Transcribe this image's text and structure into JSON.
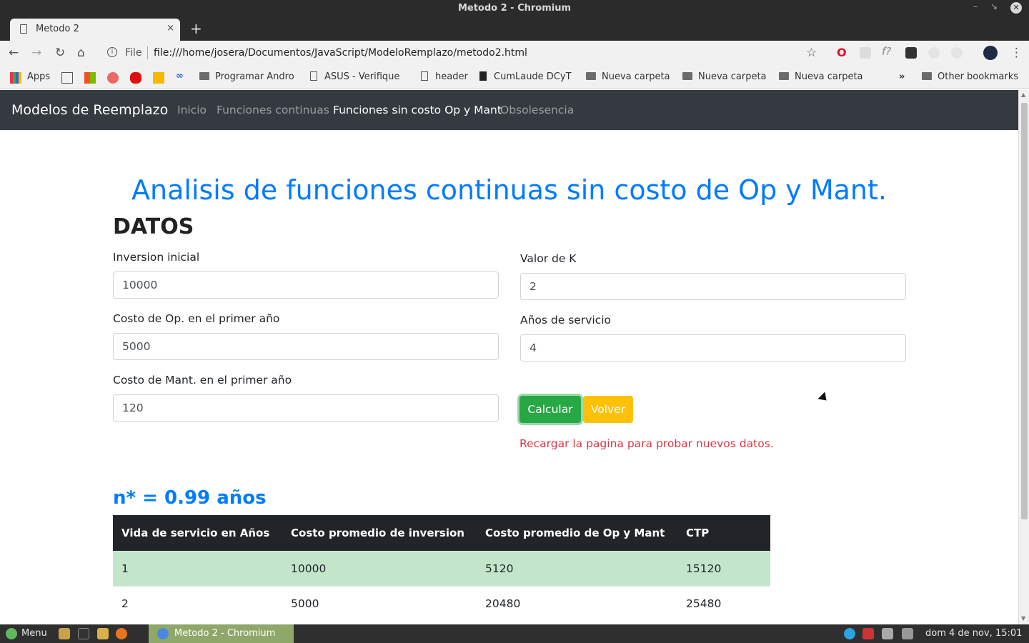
{
  "window": {
    "title": "Metodo 2 - Chromium"
  },
  "tab": {
    "label": "Metodo 2",
    "close": "×",
    "new_tab": "+"
  },
  "omnibox": {
    "scheme_label": "File",
    "url": "file:///home/josera/Documentos/JavaScript/ModeloRemplazo/metodo2.html"
  },
  "bookmarks": {
    "apps": "Apps",
    "items": [
      "Programar Andro",
      "ASUS - Verifique",
      "header",
      "CumLaude DCyT",
      "Nueva carpeta",
      "Nueva carpeta",
      "Nueva carpeta"
    ],
    "more": "»",
    "other": "Other bookmarks"
  },
  "navbar": {
    "brand": "Modelos de Reemplazo",
    "links": [
      "Inicio",
      "Funciones continuas",
      "Funciones sin costo Op y Mant",
      "Obsolesencia"
    ],
    "active_index": 2
  },
  "main": {
    "title": "Analisis de funciones continuas sin costo de Op y Mant.",
    "section_title": "DATOS",
    "fields": {
      "inversion": {
        "label": "Inversion inicial",
        "value": "10000"
      },
      "costo_op": {
        "label": "Costo de Op. en el primer año",
        "value": "5000"
      },
      "costo_mant": {
        "label": "Costo de Mant. en el primer año",
        "value": "120"
      },
      "k": {
        "label": "Valor de K",
        "value": "2"
      },
      "anios": {
        "label": "Años de servicio",
        "value": "4"
      }
    },
    "buttons": {
      "calcular": "Calcular",
      "volver": "Volver"
    },
    "message": "Recargar la pagina para probar nuevos datos.",
    "result": "n* = 0.99 años",
    "table": {
      "headers": [
        "Vida de servicio en Años",
        "Costo promedio de inversion",
        "Costo promedio de Op y Mant",
        "CTP"
      ],
      "rows": [
        [
          "1",
          "10000",
          "5120",
          "15120"
        ],
        [
          "2",
          "5000",
          "20480",
          "25480"
        ]
      ],
      "highlight_color": "#c3e6cb"
    }
  },
  "taskbar": {
    "menu": "Menu",
    "app": "Metodo 2 - Chromium",
    "clock": "dom  4 de nov, 15:01"
  },
  "colors": {
    "primary": "#007bff",
    "success": "#28a745",
    "warning": "#ffc107",
    "danger": "#dc3545",
    "navbar": "#343a40"
  }
}
